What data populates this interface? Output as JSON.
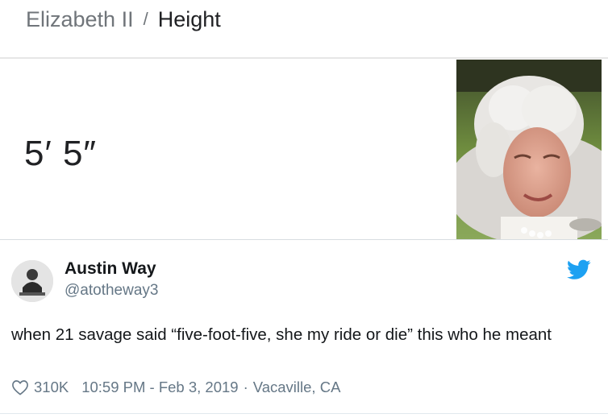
{
  "knowledge_panel": {
    "breadcrumb_parent": "Elizabeth II",
    "breadcrumb_separator": "/",
    "breadcrumb_current": "Height",
    "answer": "5′ 5″"
  },
  "tweet": {
    "display_name": "Austin Way",
    "handle": "@atotheway3",
    "text": "when 21 savage said “five-foot-five, she my ride or die” this who he meant",
    "likes": "310K",
    "timestamp": "10:59 PM - Feb 3, 2019",
    "separator": "·",
    "location": "Vacaville, CA",
    "brand_color": "#1da1f2"
  },
  "icons": [
    "heart-icon",
    "twitter-bird-icon"
  ]
}
